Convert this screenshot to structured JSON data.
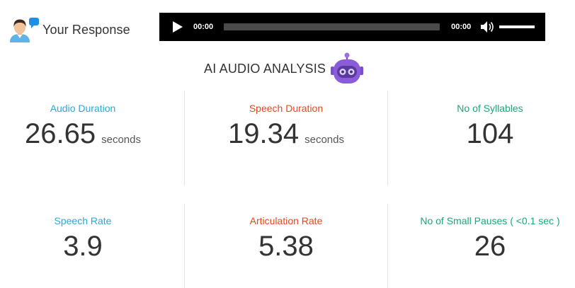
{
  "header": {
    "title": "Your Response",
    "avatar_icon": "user-avatar-icon",
    "bubble_icon": "chat-bubble-icon",
    "bubble_color": "#1f8fe6"
  },
  "audio_player": {
    "current_time": "00:00",
    "total_time": "00:00",
    "progress": 0,
    "volume": 1.0,
    "background": "#000000"
  },
  "analysis": {
    "title": "AI AUDIO ANALYSIS",
    "robot_icon": "robot-icon",
    "robot_color": "#8a5cd9"
  },
  "stats": [
    {
      "label": "Audio Duration",
      "value": "26.65",
      "unit": "seconds",
      "color": "#2aa9d6"
    },
    {
      "label": "Speech Duration",
      "value": "19.34",
      "unit": "seconds",
      "color": "#e8461c"
    },
    {
      "label": "No of Syllables",
      "value": "104",
      "unit": "",
      "color": "#1aa67a"
    },
    {
      "label": "Speech Rate",
      "value": "3.9",
      "unit": "",
      "color": "#2aa9d6"
    },
    {
      "label": "Articulation Rate",
      "value": "5.38",
      "unit": "",
      "color": "#e8461c"
    },
    {
      "label": "No of Small Pauses ( <0.1 sec )",
      "value": "26",
      "unit": "",
      "color": "#1aa67a"
    }
  ]
}
